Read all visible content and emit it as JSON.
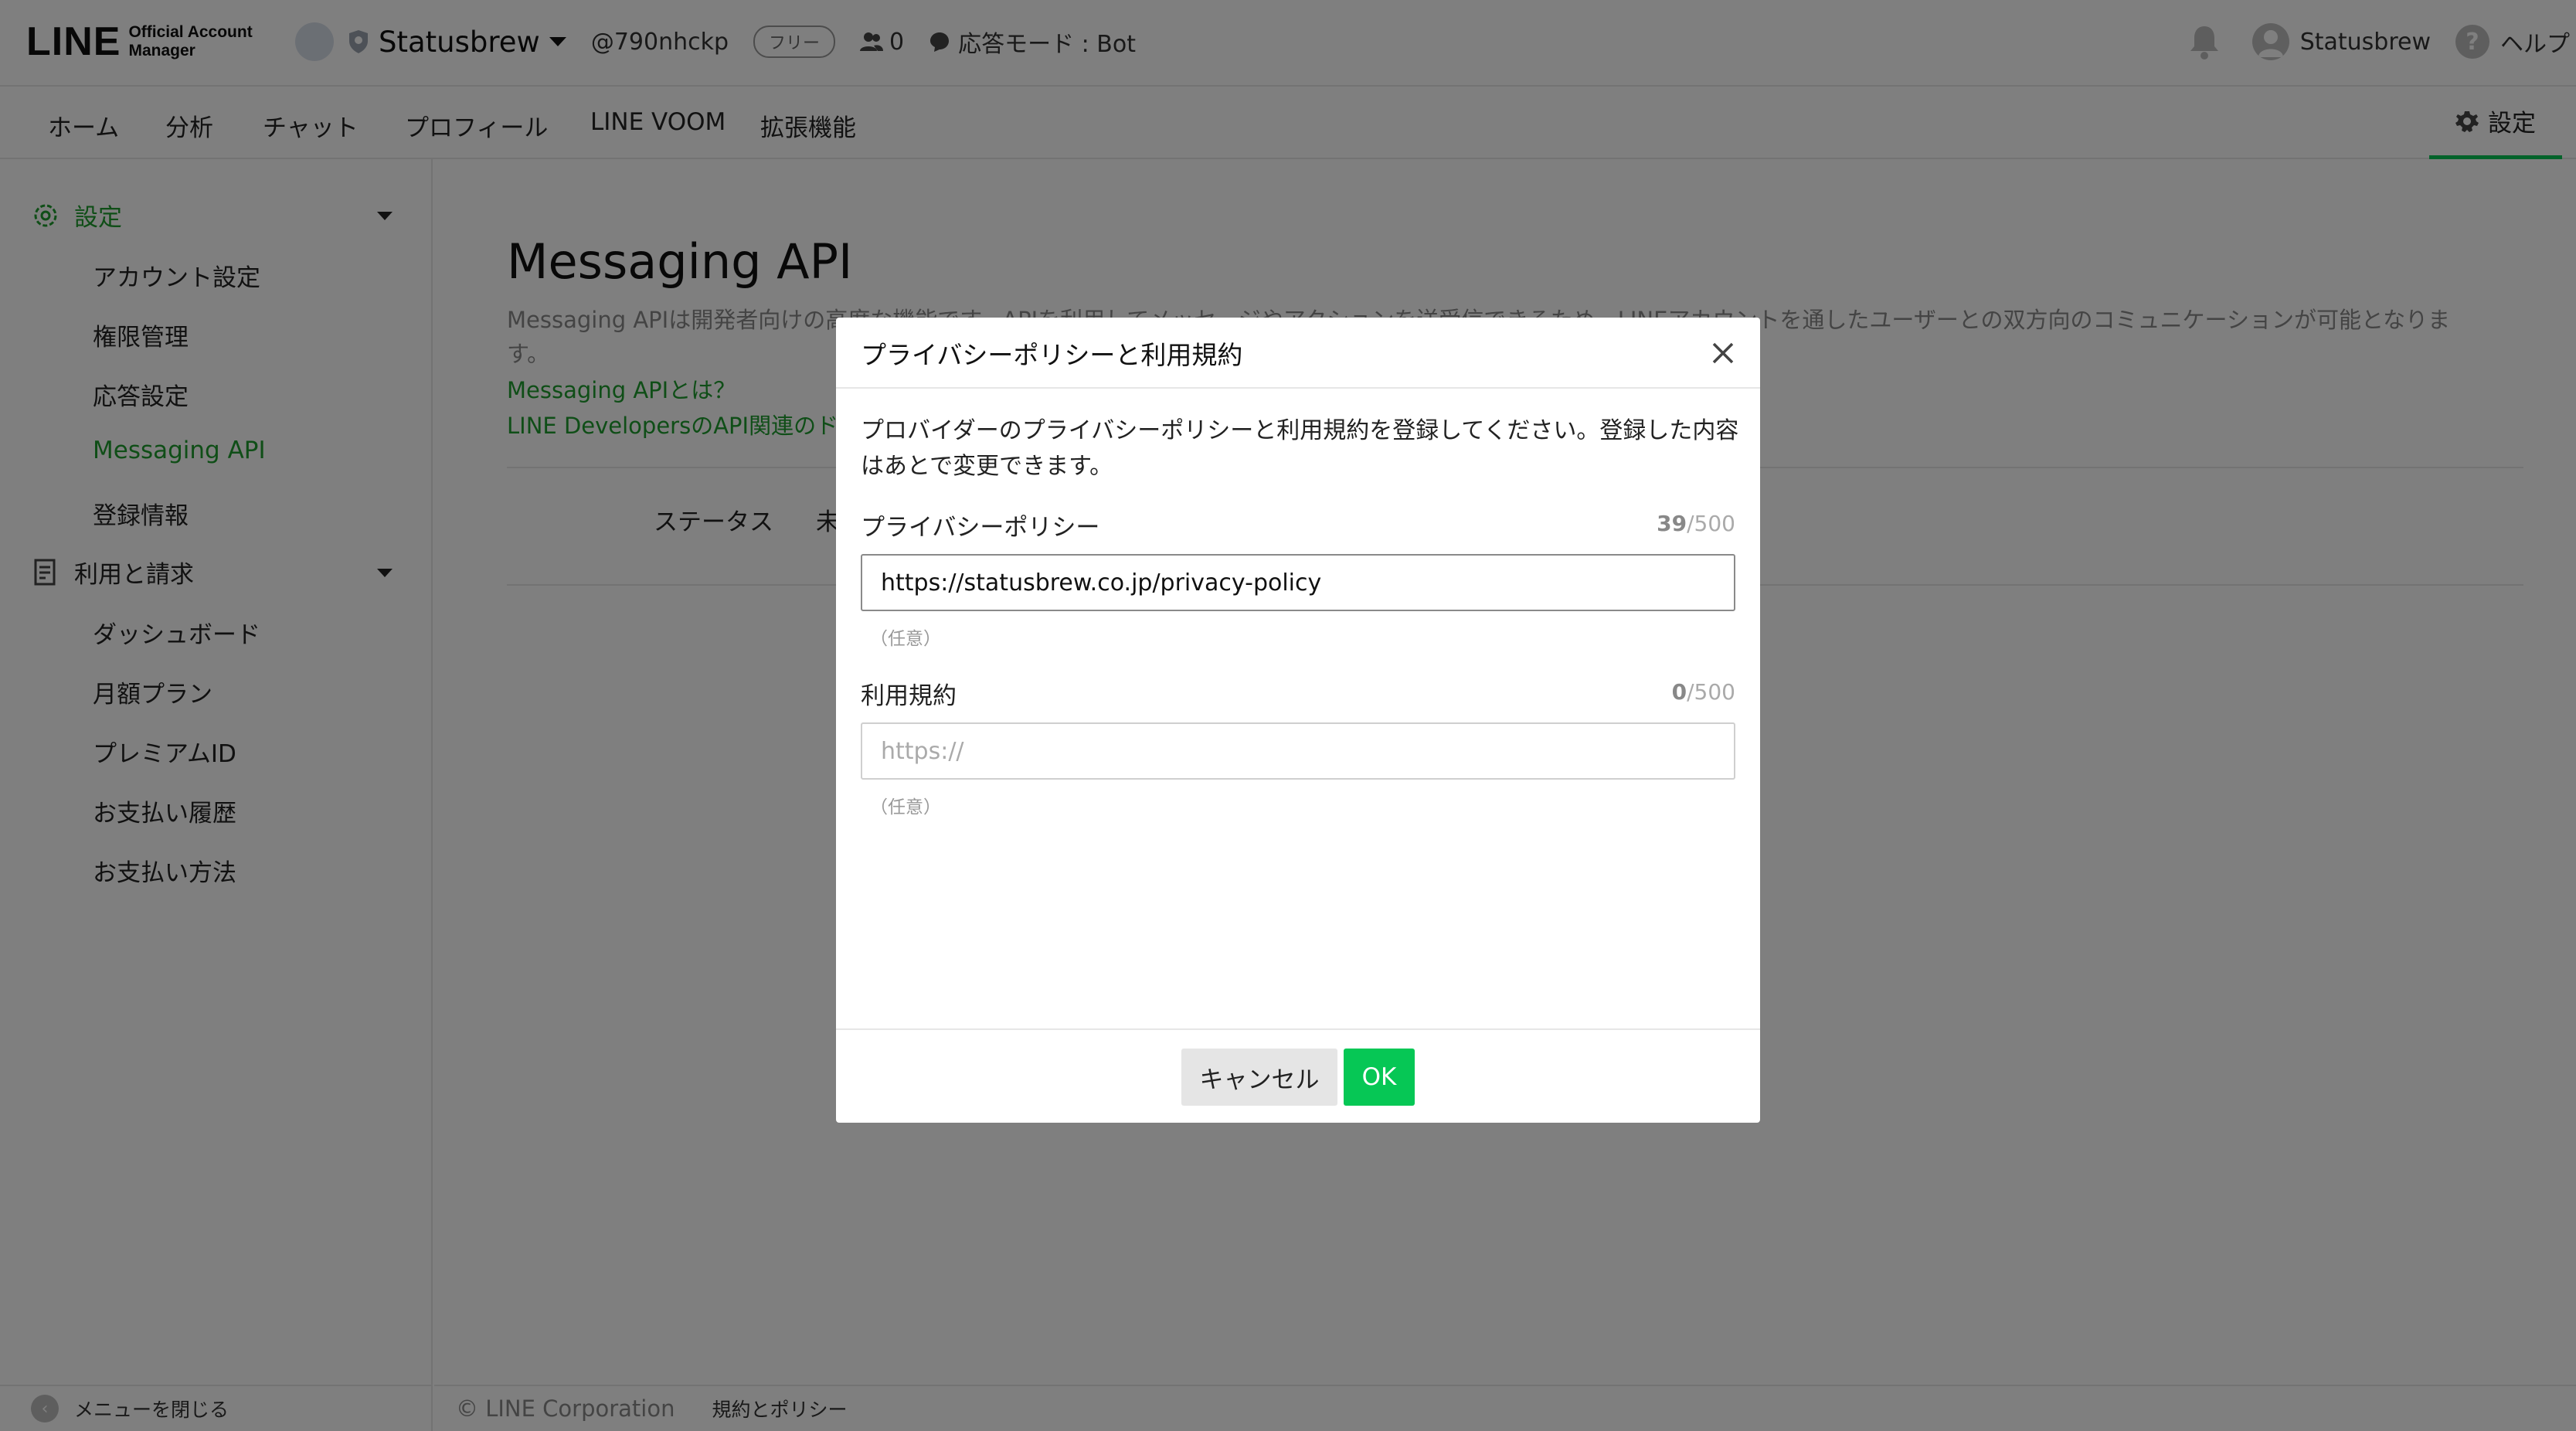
{
  "header": {
    "logo_main": "LINE",
    "logo_sub_line1": "Official Account",
    "logo_sub_line2": "Manager",
    "account_name": "Statusbrew",
    "account_id": "@790nhckp",
    "plan_badge": "フリー",
    "friend_count": "0",
    "response_mode": "応答モード : Bot",
    "user_name": "Statusbrew",
    "help_label": "ヘルプ"
  },
  "nav": {
    "items": [
      "ホーム",
      "分析",
      "チャット",
      "プロフィール",
      "LINE VOOM",
      "拡張機能"
    ],
    "settings_label": "設定"
  },
  "sidebar": {
    "group_settings": "設定",
    "settings_items": [
      "アカウント設定",
      "権限管理",
      "応答設定",
      "Messaging API",
      "登録情報"
    ],
    "active_item": "Messaging API",
    "group_billing": "利用と請求",
    "billing_items": [
      "ダッシュボード",
      "月額プラン",
      "プレミアムID",
      "お支払い履歴",
      "お支払い方法"
    ],
    "close_menu": "メニューを閉じる"
  },
  "main": {
    "title": "Messaging API",
    "desc_line1": "Messaging APIは開発者向けの高度な機能です。APIを利用してメッセージやアクションを送受信できるため、LINEアカウントを通したユーザーとの双方向のコミュニケーションが可能となりま",
    "desc_line2": "す。",
    "link_what": "Messaging APIとは？",
    "link_docs": "LINE DevelopersのAPI関連のドキ",
    "status_label": "ステータス",
    "status_value": "未",
    "footer_copyright": "© LINE Corporation",
    "footer_terms": "規約とポリシー"
  },
  "modal": {
    "title": "プライバシーポリシーと利用規約",
    "desc": "プロバイダーのプライバシーポリシーと利用規約を登録してください。登録した内容はあとで変更できます。",
    "privacy_label": "プライバシーポリシー",
    "privacy_count": "39",
    "privacy_max": "/500",
    "privacy_value": "https://statusbrew.co.jp/privacy-policy",
    "privacy_optional": "（任意）",
    "terms_label": "利用規約",
    "terms_count": "0",
    "terms_max": "/500",
    "terms_placeholder": "https://",
    "terms_optional": "（任意）",
    "cancel_label": "キャンセル",
    "ok_label": "OK"
  },
  "colors": {
    "brand_green": "#06c755",
    "link_green": "#1f9c2e",
    "overlay": "rgba(0,0,0,0.5)"
  }
}
